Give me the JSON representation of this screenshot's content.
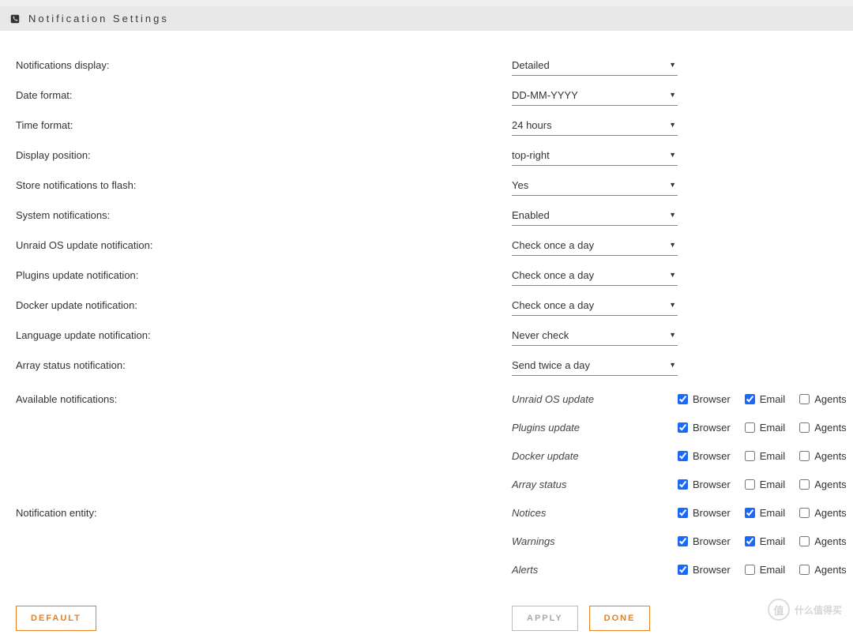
{
  "header": {
    "title": "Notification Settings"
  },
  "settings": [
    {
      "label": "Notifications display:",
      "value": "Detailed"
    },
    {
      "label": "Date format:",
      "value": "DD-MM-YYYY"
    },
    {
      "label": "Time format:",
      "value": "24 hours"
    },
    {
      "label": "Display position:",
      "value": "top-right"
    },
    {
      "label": "Store notifications to flash:",
      "value": "Yes"
    },
    {
      "label": "System notifications:",
      "value": "Enabled"
    },
    {
      "label": "Unraid OS update notification:",
      "value": "Check once a day"
    },
    {
      "label": "Plugins update notification:",
      "value": "Check once a day"
    },
    {
      "label": "Docker update notification:",
      "value": "Check once a day"
    },
    {
      "label": "Language update notification:",
      "value": "Never check"
    },
    {
      "label": "Array status notification:",
      "value": "Send twice a day"
    }
  ],
  "availableLabel": "Available notifications:",
  "entityLabel": "Notification entity:",
  "checkLabels": {
    "browser": "Browser",
    "email": "Email",
    "agents": "Agents"
  },
  "available": [
    {
      "name": "Unraid OS update",
      "browser": true,
      "email": true,
      "agents": false
    },
    {
      "name": "Plugins update",
      "browser": true,
      "email": false,
      "agents": false
    },
    {
      "name": "Docker update",
      "browser": true,
      "email": false,
      "agents": false
    },
    {
      "name": "Array status",
      "browser": true,
      "email": false,
      "agents": false
    }
  ],
  "entity": [
    {
      "name": "Notices",
      "browser": true,
      "email": true,
      "agents": false
    },
    {
      "name": "Warnings",
      "browser": true,
      "email": true,
      "agents": false
    },
    {
      "name": "Alerts",
      "browser": true,
      "email": false,
      "agents": false
    }
  ],
  "buttons": {
    "default": "Default",
    "apply": "Apply",
    "done": "Done"
  },
  "watermark": "什么值得买"
}
